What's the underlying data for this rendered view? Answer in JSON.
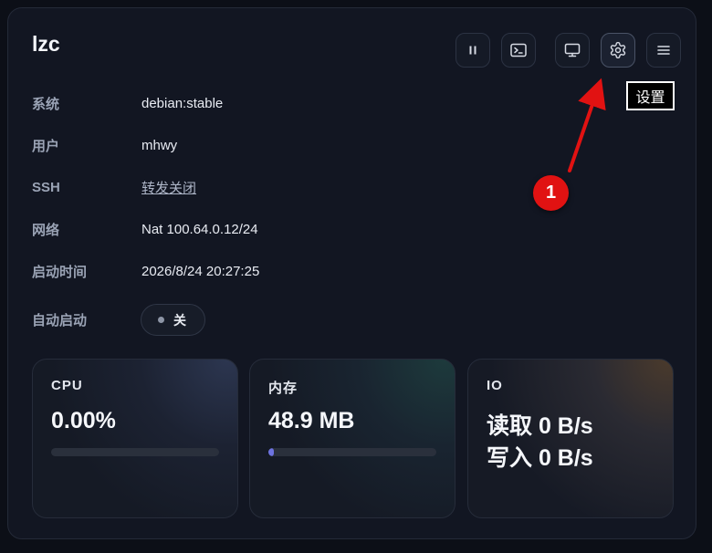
{
  "vm": {
    "name": "lzc"
  },
  "toolbar": {
    "buttons": [
      {
        "id": "pause",
        "icon": "pause-icon"
      },
      {
        "id": "terminal",
        "icon": "terminal-icon"
      },
      {
        "id": "display",
        "icon": "monitor-icon"
      },
      {
        "id": "settings",
        "icon": "gear-icon"
      },
      {
        "id": "menu",
        "icon": "hamburger-menu-icon"
      }
    ],
    "tooltip": "设置"
  },
  "annotation": {
    "step": "1",
    "color": "#e11212"
  },
  "info": {
    "system": {
      "label": "系统",
      "value": "debian:stable"
    },
    "user": {
      "label": "用户",
      "value": "mhwy"
    },
    "ssh": {
      "label": "SSH",
      "value": "转发关闭"
    },
    "network": {
      "label": "网络",
      "value": "Nat 100.64.0.12/24"
    },
    "boot_time": {
      "label": "启动时间",
      "value": "2026/8/24 20:27:25"
    },
    "autostart": {
      "label": "自动启动",
      "toggle_label": "关",
      "on": false
    }
  },
  "stats": {
    "cpu": {
      "title": "CPU",
      "value": "0.00%",
      "usage_fraction": 0.0
    },
    "memory": {
      "title": "内存",
      "value": "48.9 MB",
      "usage_fraction": 0.03,
      "bar_color": "#6d73e0"
    },
    "io": {
      "title": "IO",
      "read": "读取 0 B/s",
      "write": "写入 0 B/s"
    }
  }
}
